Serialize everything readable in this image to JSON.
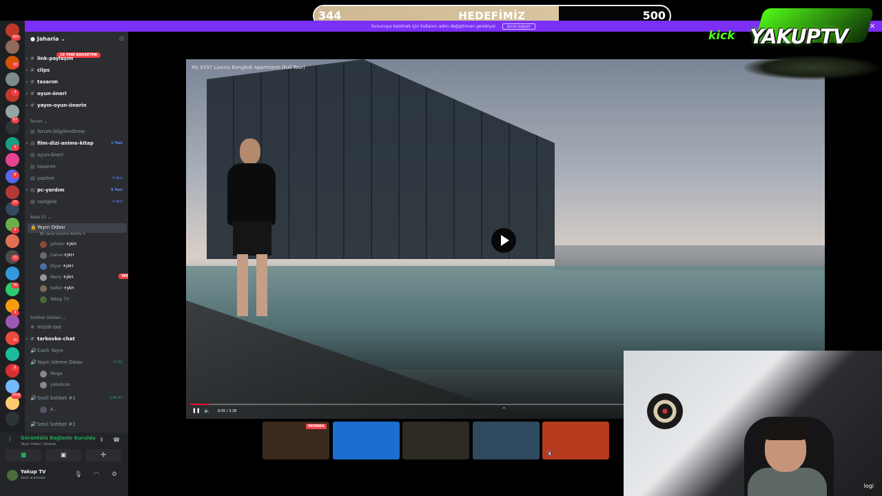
{
  "goal": {
    "current": "344",
    "label": "HEDEFİMİZ",
    "max": "500",
    "fraction": 0.688
  },
  "notice": {
    "text": "Sunucuya katılmak için kullanıcı adını değiştirmen gerekiyor.",
    "button": "Şimdi değiştir"
  },
  "server": {
    "name": "Jaharia",
    "new_badge": "19 YENİ BAHSETME"
  },
  "rail_badges": [
    "397",
    "10",
    "4",
    "67",
    "3",
    "8",
    "25",
    "4",
    "31",
    "36",
    "4",
    "20",
    "6",
    "YENİ"
  ],
  "channels": {
    "top": [
      {
        "name": "link-paylaşım",
        "bright": true
      },
      {
        "name": "clips",
        "bright": true
      },
      {
        "name": "tasarım",
        "bright": true
      },
      {
        "name": "oyun-öneri",
        "bright": true
      },
      {
        "name": "yayın-oyun-önerin",
        "bright": true
      }
    ],
    "forum_category": "forum",
    "forum": [
      {
        "name": "forum-bilgilendirme",
        "bright": false,
        "count": ""
      },
      {
        "name": "film-dizi-anime-kitap",
        "bright": true,
        "count": "1 Yeni"
      },
      {
        "name": "oyun-öneri",
        "bright": false,
        "count": ""
      },
      {
        "name": "tasarım",
        "bright": false,
        "count": ""
      },
      {
        "name": "yazılım",
        "bright": false,
        "count": "4 Yeni"
      },
      {
        "name": "pc-yardım",
        "bright": true,
        "count": "9 Yeni"
      },
      {
        "name": "rastgele",
        "bright": false,
        "count": "4 Yeni"
      }
    ],
    "area_category": "Area 51",
    "voice_room": {
      "name": "Yayın Odası",
      "status": "Bir kanal durumu belirle"
    },
    "voice_users": [
      {
        "name": "jahrein",
        "tag": "JAH",
        "live": "YAYINDA"
      },
      {
        "name": "Caine",
        "tag": "JAH"
      },
      {
        "name": "Diyar",
        "tag": "JAH"
      },
      {
        "name": "Meriç",
        "tag": "JAH"
      },
      {
        "name": "Seferi",
        "tag": "JAH"
      },
      {
        "name": "Yakup TV",
        "tag": ""
      }
    ],
    "chat_category": "Sohbet Odaları",
    "chat": [
      {
        "name": "müzik-bot",
        "bright": false
      },
      {
        "name": "tarkovke-chat",
        "bright": true
      },
      {
        "name": "Canlı Yayın",
        "bright": false
      },
      {
        "name": "Yayın İzleme Odası",
        "bright": false,
        "time": "17:32"
      }
    ],
    "izleme_users": [
      "INuga",
      "yakubcan"
    ],
    "sesli1": {
      "name": "Sesli Sohbet #1",
      "time": "1:49:47",
      "user": "A..."
    },
    "sesli2": {
      "name": "Sesli Sohbet #2"
    }
  },
  "voice_panel": {
    "title": "Görüntülü Bağlantı Kuruldu",
    "sub": "Yayın Odası / Jaharia"
  },
  "me": {
    "name": "Yakup TV",
    "status": "Sesli aramada"
  },
  "video": {
    "title": "My $557 Luxury Bangkok Apartment (Full Tour)",
    "time": "0:05 / 3:28",
    "progress": 0.03
  },
  "tiles": [
    {
      "live": "YAYINDA",
      "color": "#3a2a1e"
    },
    {
      "live": "",
      "color": "#1a6fd0"
    },
    {
      "live": "",
      "color": "#2c2a22"
    },
    {
      "live": "",
      "color": "#2f4a5e"
    },
    {
      "live": "",
      "color": "#b63a1e"
    }
  ],
  "logo": {
    "kick": "kick",
    "brand": "YAKUPTV"
  },
  "cam": {
    "corner": "logi"
  }
}
